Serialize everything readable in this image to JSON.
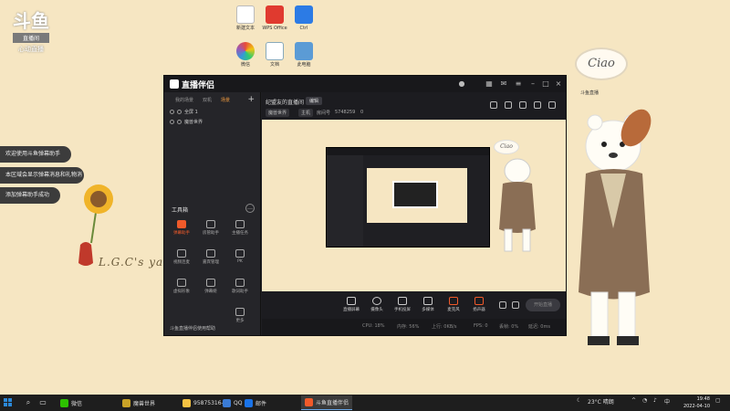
{
  "desktop": {
    "brand": {
      "big": "斗鱼",
      "tag": "直播间",
      "sub": "心动直播"
    },
    "icons": [
      {
        "label": "新建文本"
      },
      {
        "label": "WPS Office"
      },
      {
        "label": "Ctrl"
      },
      {
        "label": "微信"
      },
      {
        "label": "文档"
      },
      {
        "label": "此电脑"
      }
    ],
    "notices": [
      "欢迎使用斗鱼弹幕助手",
      "本区域会显示弹幕消息和礼物消息",
      "添加弹幕助手成功"
    ],
    "signature": "L.G.C's yard",
    "ciao": "Ciao",
    "clock_widget": "斗鱼直播"
  },
  "app": {
    "title": "直播伴侣",
    "left_tabs": [
      "我的场景",
      "双机",
      "场景"
    ],
    "scenes": [
      {
        "label": "全屏 1"
      },
      {
        "label": "魔兽世界"
      }
    ],
    "tools_title": "工具箱",
    "tools": [
      {
        "label": "弹幕助手",
        "active": true
      },
      {
        "label": "房管助手"
      },
      {
        "label": "主播任务"
      },
      {
        "label": "视频连麦"
      },
      {
        "label": "嘉宾管理"
      },
      {
        "label": "PK"
      },
      {
        "label": "虚拟形象"
      },
      {
        "label": "弹幕姬"
      },
      {
        "label": "歌词助手"
      },
      {
        "label": "更多"
      }
    ],
    "status_text": "斗鱼直播伴侣使用帮助",
    "header": {
      "title": "纪盟友的直播间",
      "edit": "编辑",
      "category": "魔兽世界",
      "tag": "主机",
      "room_label": "房间号",
      "room_id": "5748259",
      "hot_count": "0"
    },
    "bottom_tools": [
      {
        "label": "直播屏幕"
      },
      {
        "label": "摄像头"
      },
      {
        "label": "手机投屏"
      },
      {
        "label": "多媒体"
      },
      {
        "label": "麦克风"
      },
      {
        "label": "扬声器"
      }
    ],
    "start_live": "开始直播",
    "status_items": [
      "CPU: 18%",
      "内存: 56%",
      "上行: 0KB/s",
      "FPS: 0",
      "丢帧: 0%",
      "延迟: 0ms"
    ]
  },
  "taskbar": {
    "apps": [
      {
        "label": "微信",
        "color": "#2dc100"
      },
      {
        "label": "魔兽世界",
        "color": "#c9a227"
      },
      {
        "label": "95875316-",
        "color": "#f5c242"
      },
      {
        "label": "QQ",
        "color": "#3a7bd5"
      },
      {
        "label": "邮件",
        "color": "#1a73e8"
      },
      {
        "label": "斗鱼直播伴侣",
        "color": "#f05a2a",
        "active": true
      }
    ],
    "weather": "23°C 晴朗",
    "time": "19:48",
    "date": "2022-04-10"
  },
  "colors": {
    "accent": "#f05a2a",
    "window_bg": "#1f1f23",
    "desktop_bg": "#f6e6c2"
  }
}
